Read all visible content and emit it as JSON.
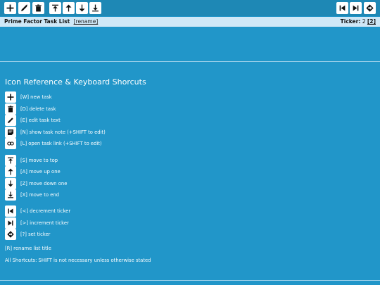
{
  "toolbar": {
    "left_buttons": [
      "plus-icon",
      "pencil-icon",
      "trash-icon",
      "to-top-icon",
      "arrow-up-icon",
      "arrow-down-icon",
      "to-bottom-icon"
    ],
    "right_buttons": [
      "skip-previous-icon",
      "skip-next-icon",
      "diamond-icon"
    ]
  },
  "list": {
    "title": "Prime Factor Task List",
    "rename_label": "[rename]",
    "ticker_label": "Ticker:",
    "ticker_value_plain": "2",
    "ticker_value_link": "[2]"
  },
  "reference": {
    "heading": "Icon Reference & Keyboard Shorcuts",
    "items": [
      {
        "icon": "plus-icon",
        "text": "[W] new task"
      },
      {
        "icon": "trash-icon",
        "text": "[D] delete task"
      },
      {
        "icon": "pencil-icon",
        "text": "[E] edit task text"
      },
      {
        "icon": "note-icon",
        "text": "[N] show task note (+SHIFT to edit)"
      },
      {
        "icon": "link-icon",
        "text": "[L] open task link (+SHIFT to edit)"
      },
      {
        "icon": "to-top-icon",
        "text": "[S] move to top"
      },
      {
        "icon": "arrow-up-icon",
        "text": "[A] move up one"
      },
      {
        "icon": "arrow-down-icon",
        "text": "[Z] move down one"
      },
      {
        "icon": "to-bottom-icon",
        "text": "[X] move to end"
      },
      {
        "icon": "skip-previous-icon",
        "text": "[<] decrement ticker"
      },
      {
        "icon": "skip-next-icon",
        "text": "[>] increment ticker"
      },
      {
        "icon": "diamond-icon",
        "text": "[?] set ticker"
      }
    ],
    "rename_note": "[R] rename list title",
    "shift_note": "All Shortcuts: SHIFT is not necessary unless otherwise stated"
  }
}
